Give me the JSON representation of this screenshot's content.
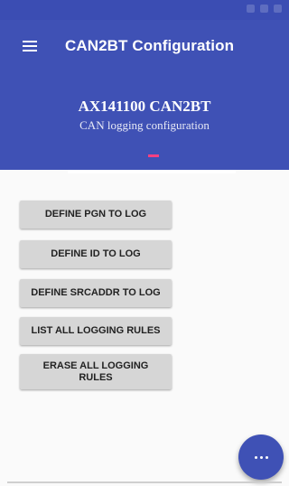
{
  "app_bar": {
    "title": "CAN2BT Configuration",
    "menu_icon": "hamburger-menu-icon",
    "color": "#3f51b5"
  },
  "header": {
    "title": "AX141100 CAN2BT",
    "subtitle": "CAN logging configuration",
    "indicator_color": "#ff4081"
  },
  "buttons": [
    {
      "label": "DEFINE PGN TO LOG"
    },
    {
      "label": "DEFINE ID TO LOG"
    },
    {
      "label": "DEFINE SRCADDR TO LOG"
    },
    {
      "label": "LIST ALL LOGGING RULES"
    },
    {
      "label": "ERASE ALL LOGGING RULES"
    }
  ],
  "fab": {
    "icon": "more-horizontal-icon",
    "color": "#3f51b5"
  }
}
